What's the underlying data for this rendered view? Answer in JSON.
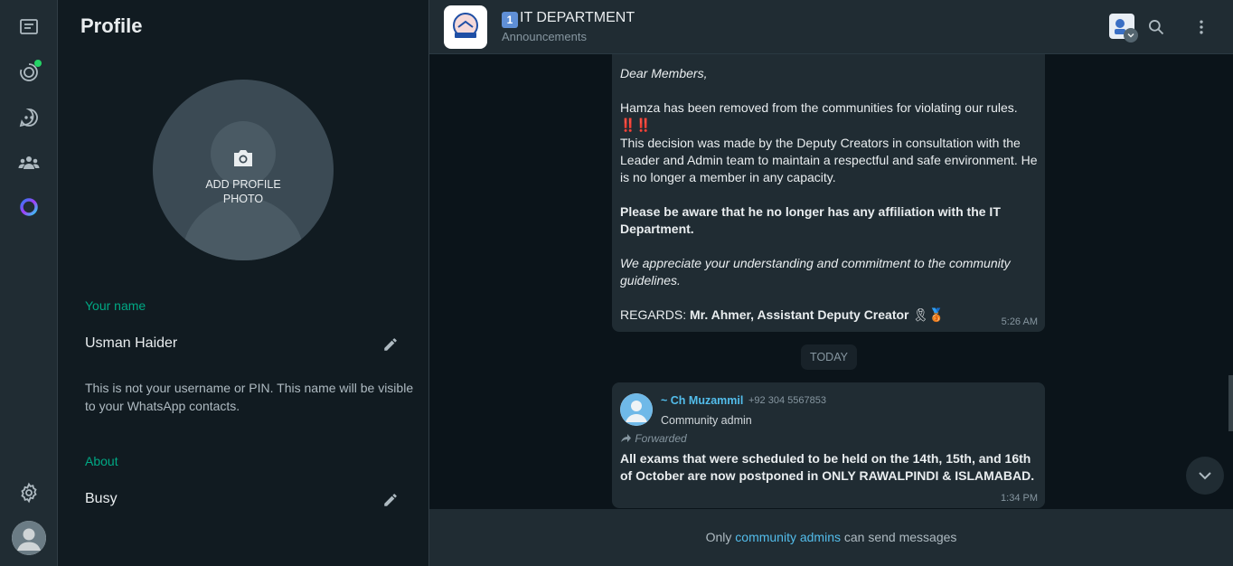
{
  "rail": {
    "icons": [
      "chats-icon",
      "status-icon",
      "channels-icon",
      "communities-icon",
      "meta-ai-icon",
      "settings-icon"
    ]
  },
  "profile": {
    "title": "Profile",
    "add_photo_label_1": "ADD PROFILE",
    "add_photo_label_2": "PHOTO",
    "name_label": "Your name",
    "name_value": "Usman Haider",
    "name_hint": "This is not your username or PIN. This name will be visible to your WhatsApp contacts.",
    "about_label": "About",
    "about_value": "Busy"
  },
  "chat": {
    "header": {
      "keycap": "1",
      "title": "IT DEPARTMENT",
      "subtitle": "Announcements"
    },
    "message1": {
      "greeting": "Dear Members,",
      "line1": "Hamza has been removed from the communities for violating our rules.",
      "alarm": "‼️‼️",
      "line2": "This decision was made by the Deputy Creators in consultation with the Leader and Admin team to maintain a respectful and safe environment. He is no longer a member in any capacity.",
      "bold_notice": "Please be aware that he no longer has any affiliation with the IT Department.",
      "appreciation": "We appreciate your understanding and commitment to the community guidelines.",
      "regards_prefix": "REGARDS: ",
      "regards_name": "Mr. Ahmer, Assistant Deputy Creator",
      "regards_emoji": "🎗🥉",
      "time": "5:26 AM"
    },
    "date_divider": "TODAY",
    "message2": {
      "sender_name": "~ Ch Muzammil",
      "sender_phone": "+92 304 5567853",
      "sender_role": "Community admin",
      "forwarded": "Forwarded",
      "text": "All exams that were scheduled to be held on the 14th, 15th, and 16th of October are now postponed in ONLY RAWALPINDI & ISLAMABAD.",
      "time": "1:34 PM"
    },
    "footer": {
      "prefix": "Only ",
      "link": "community admins",
      "suffix": " can send messages"
    }
  },
  "colors": {
    "accent": "#00a884",
    "link": "#53bdeb",
    "panel": "#111b21",
    "header": "#202c33",
    "background": "#0b141a",
    "bubble": "#202c33"
  }
}
